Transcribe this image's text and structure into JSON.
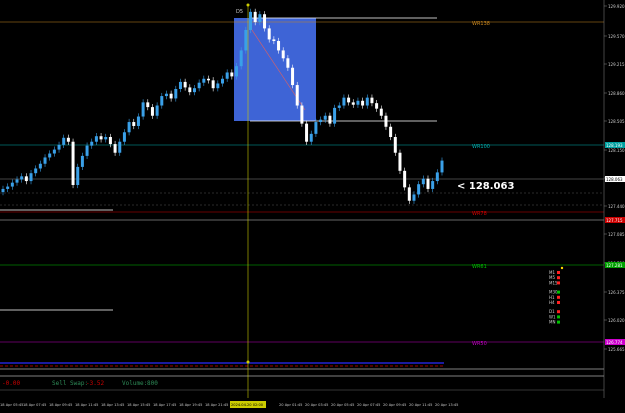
{
  "chart_data": {
    "type": "candlestick",
    "period_label": "D5",
    "current_price": "< 128.063",
    "y_ticks": [
      "129.920",
      "129.570",
      "129.215",
      "128.860",
      "128.505",
      "128.150",
      "127.795",
      "127.440",
      "127.085",
      "126.730",
      "126.375",
      "126.020",
      "125.665"
    ],
    "y_ticks_small": [
      "129.920",
      "129.570",
      "129.215",
      "128.860",
      "128.505",
      "128.150",
      "127.795",
      "127.440",
      "127.085",
      "126.730",
      "126.375",
      "126.020",
      "125.665"
    ],
    "price_tags": [
      {
        "text": "128.193",
        "color": "#00a0a0"
      },
      {
        "text": "128.063",
        "color": "#ffffff"
      },
      {
        "text": "127.715",
        "color": "#cc0000"
      },
      {
        "text": "127.281",
        "color": "#00a000"
      },
      {
        "text": "126.774",
        "color": "#cc00cc"
      }
    ],
    "levels": [
      {
        "name": "WR138",
        "color": "#c8861e"
      },
      {
        "name": "WR100",
        "color": "#00b0b0"
      },
      {
        "name": "WR78",
        "color": "#d00000"
      },
      {
        "name": "WR61",
        "color": "#00c000"
      },
      {
        "name": "WR50",
        "color": "#c000c0"
      }
    ],
    "x_ticks": [
      "18 Apr 05:45",
      "18 Apr 07:45",
      "18 Apr 09:45",
      "18 Apr 11:45",
      "18 Apr 13:45",
      "18 Apr 15:45",
      "18 Apr 17:45",
      "18 Apr 19:45",
      "18 Apr 21:45",
      "2024.04.20 02:00",
      "20 Apr 01:45",
      "20 Apr 03:45",
      "20 Apr 05:45",
      "20 Apr 07:45",
      "20 Apr 09:45",
      "20 Apr 11:45",
      "20 Apr 13:45"
    ],
    "timeframes": [
      "M1",
      "M5",
      "M15",
      "M30",
      "H1",
      "H4",
      "D1",
      "W1",
      "MN"
    ],
    "timeframe_colors": [
      "#ff2020",
      "#ff2020",
      "#ff2020",
      "#00c000",
      "#ff2020",
      "#ff2020",
      "#ff2020",
      "#00c000",
      "#00c000"
    ],
    "close_series": [
      127.7,
      127.73,
      127.78,
      127.82,
      127.86,
      127.8,
      127.9,
      127.96,
      128.02,
      128.1,
      128.15,
      128.2,
      128.26,
      128.35,
      128.3,
      127.75,
      127.98,
      128.12,
      128.25,
      128.3,
      128.37,
      128.33,
      128.36,
      128.27,
      128.16,
      128.3,
      128.42,
      128.55,
      128.5,
      128.62,
      128.8,
      128.74,
      128.63,
      128.76,
      128.88,
      128.91,
      128.85,
      128.97,
      129.06,
      128.99,
      128.93,
      128.98,
      129.05,
      129.1,
      129.08,
      128.98,
      129.04,
      129.1,
      129.18,
      129.13,
      129.26,
      129.46,
      129.72,
      129.95,
      129.82,
      129.92,
      129.74,
      129.6,
      129.58,
      129.46,
      129.36,
      129.24,
      129.02,
      128.76,
      128.53,
      128.3,
      128.4,
      128.55,
      128.58,
      128.63,
      128.53,
      128.73,
      128.76,
      128.86,
      128.8,
      128.77,
      128.82,
      128.76,
      128.86,
      128.79,
      128.72,
      128.63,
      128.49,
      128.36,
      128.16,
      127.93,
      127.72,
      127.55,
      127.63,
      127.76,
      127.83,
      127.7,
      127.8,
      127.91,
      128.06
    ],
    "open_series": [
      127.66,
      127.7,
      127.73,
      127.78,
      127.82,
      127.86,
      127.8,
      127.9,
      127.96,
      128.02,
      128.1,
      128.15,
      128.2,
      128.26,
      128.35,
      128.3,
      127.75,
      127.98,
      128.12,
      128.25,
      128.3,
      128.37,
      128.33,
      128.36,
      128.27,
      128.16,
      128.3,
      128.42,
      128.55,
      128.5,
      128.62,
      128.8,
      128.74,
      128.63,
      128.76,
      128.88,
      128.91,
      128.85,
      128.97,
      129.06,
      128.99,
      128.93,
      128.98,
      129.05,
      129.1,
      129.08,
      128.98,
      129.04,
      129.1,
      129.18,
      129.13,
      129.26,
      129.46,
      129.72,
      129.95,
      129.82,
      129.92,
      129.74,
      129.6,
      129.58,
      129.46,
      129.36,
      129.24,
      129.02,
      128.76,
      128.53,
      128.3,
      128.4,
      128.55,
      128.58,
      128.63,
      128.53,
      128.73,
      128.76,
      128.86,
      128.8,
      128.77,
      128.82,
      128.76,
      128.86,
      128.79,
      128.72,
      128.63,
      128.49,
      128.36,
      128.16,
      127.93,
      127.72,
      127.55,
      127.63,
      127.76,
      127.83,
      127.7,
      127.8,
      127.91
    ],
    "ylim": [
      125.45,
      130.05
    ]
  },
  "status": {
    "profit": "-0.00",
    "sell_swap_label": "Sell Swap:",
    "sell_swap_value": "-3.52",
    "volume_label": "Volume:",
    "volume_value": "800"
  },
  "colors": {
    "bull": "#3aa0e8",
    "bear": "#ffffff",
    "box": "#4169e1",
    "vline": "#cccc00"
  }
}
